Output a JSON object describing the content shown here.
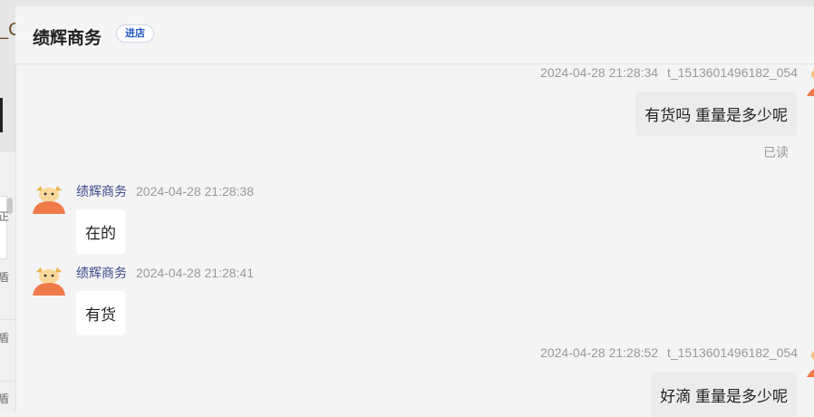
{
  "left_panel": {
    "tab_text": "_C",
    "chars": [
      "正",
      "盾",
      "盾",
      "盾"
    ]
  },
  "header": {
    "shop_name": "绩辉商务",
    "enter_label": "进店"
  },
  "messages": [
    {
      "direction": "out",
      "timestamp": "2024-04-28 21:28:34",
      "sender": "t_1513601496182_054",
      "text": "有货吗 重量是多少呢",
      "status": "已读"
    },
    {
      "direction": "in",
      "sender": "绩辉商务",
      "timestamp": "2024-04-28 21:28:38",
      "text": "在的"
    },
    {
      "direction": "in",
      "sender": "绩辉商务",
      "timestamp": "2024-04-28 21:28:41",
      "text": "有货"
    },
    {
      "direction": "out",
      "timestamp": "2024-04-28 21:28:52",
      "sender": "t_1513601496182_054",
      "text": "好滴 重量是多少呢"
    }
  ],
  "icons": {
    "shop_avatar": "bull-mascot-icon",
    "user_avatar": "user-avatar-icon"
  },
  "colors": {
    "sender_name": "#3b4a8a",
    "enter_button": "#2458c9",
    "avatar_orange": "#f07a4a"
  }
}
